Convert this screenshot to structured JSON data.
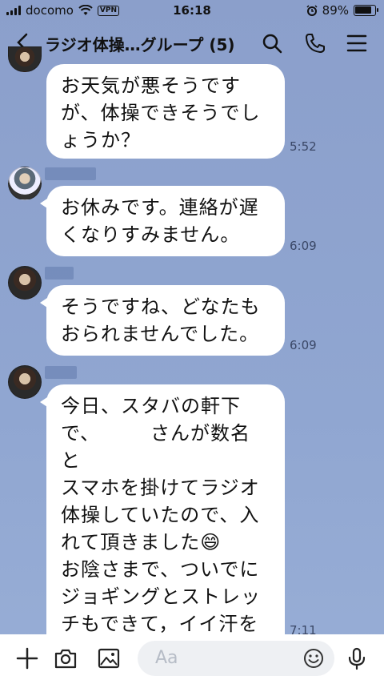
{
  "status": {
    "carrier": "docomo",
    "vpn": "VPN",
    "time": "16:18",
    "battery": "89%",
    "battery_level": 0.89
  },
  "header": {
    "title": "ラジオ体操…グループ (5)"
  },
  "messages": [
    {
      "text": "お天気が悪そうです\nが、体操できそうでし\nょうか？",
      "time": "5:52"
    },
    {
      "text": "お休みです。連絡が遅\nくなりすみません。",
      "time": "6:09"
    },
    {
      "text": "そうですね、どなたも\nおられませんでした。",
      "time": "6:09"
    },
    {
      "text": "今日、スタバの軒下\nで、　　　さんが数名と\nスマホを掛けてラジオ\n体操していたので、入\nれて頂きました😄\nお陰さまで、ついでに\nジョギングとストレッ\nチもできて，イイ汗を\nかきました✌",
      "time": "7:11"
    }
  ],
  "input": {
    "placeholder": "Aa"
  },
  "icons": {
    "back": "chevron-left-icon",
    "search": "search-icon",
    "call": "phone-icon",
    "menu": "menu-icon",
    "plus": "plus-icon",
    "camera": "camera-icon",
    "image": "image-icon",
    "emoji": "emoji-icon",
    "mic": "mic-icon"
  },
  "colors": {
    "background": "#8ea4cf",
    "bubble": "#ffffff"
  }
}
